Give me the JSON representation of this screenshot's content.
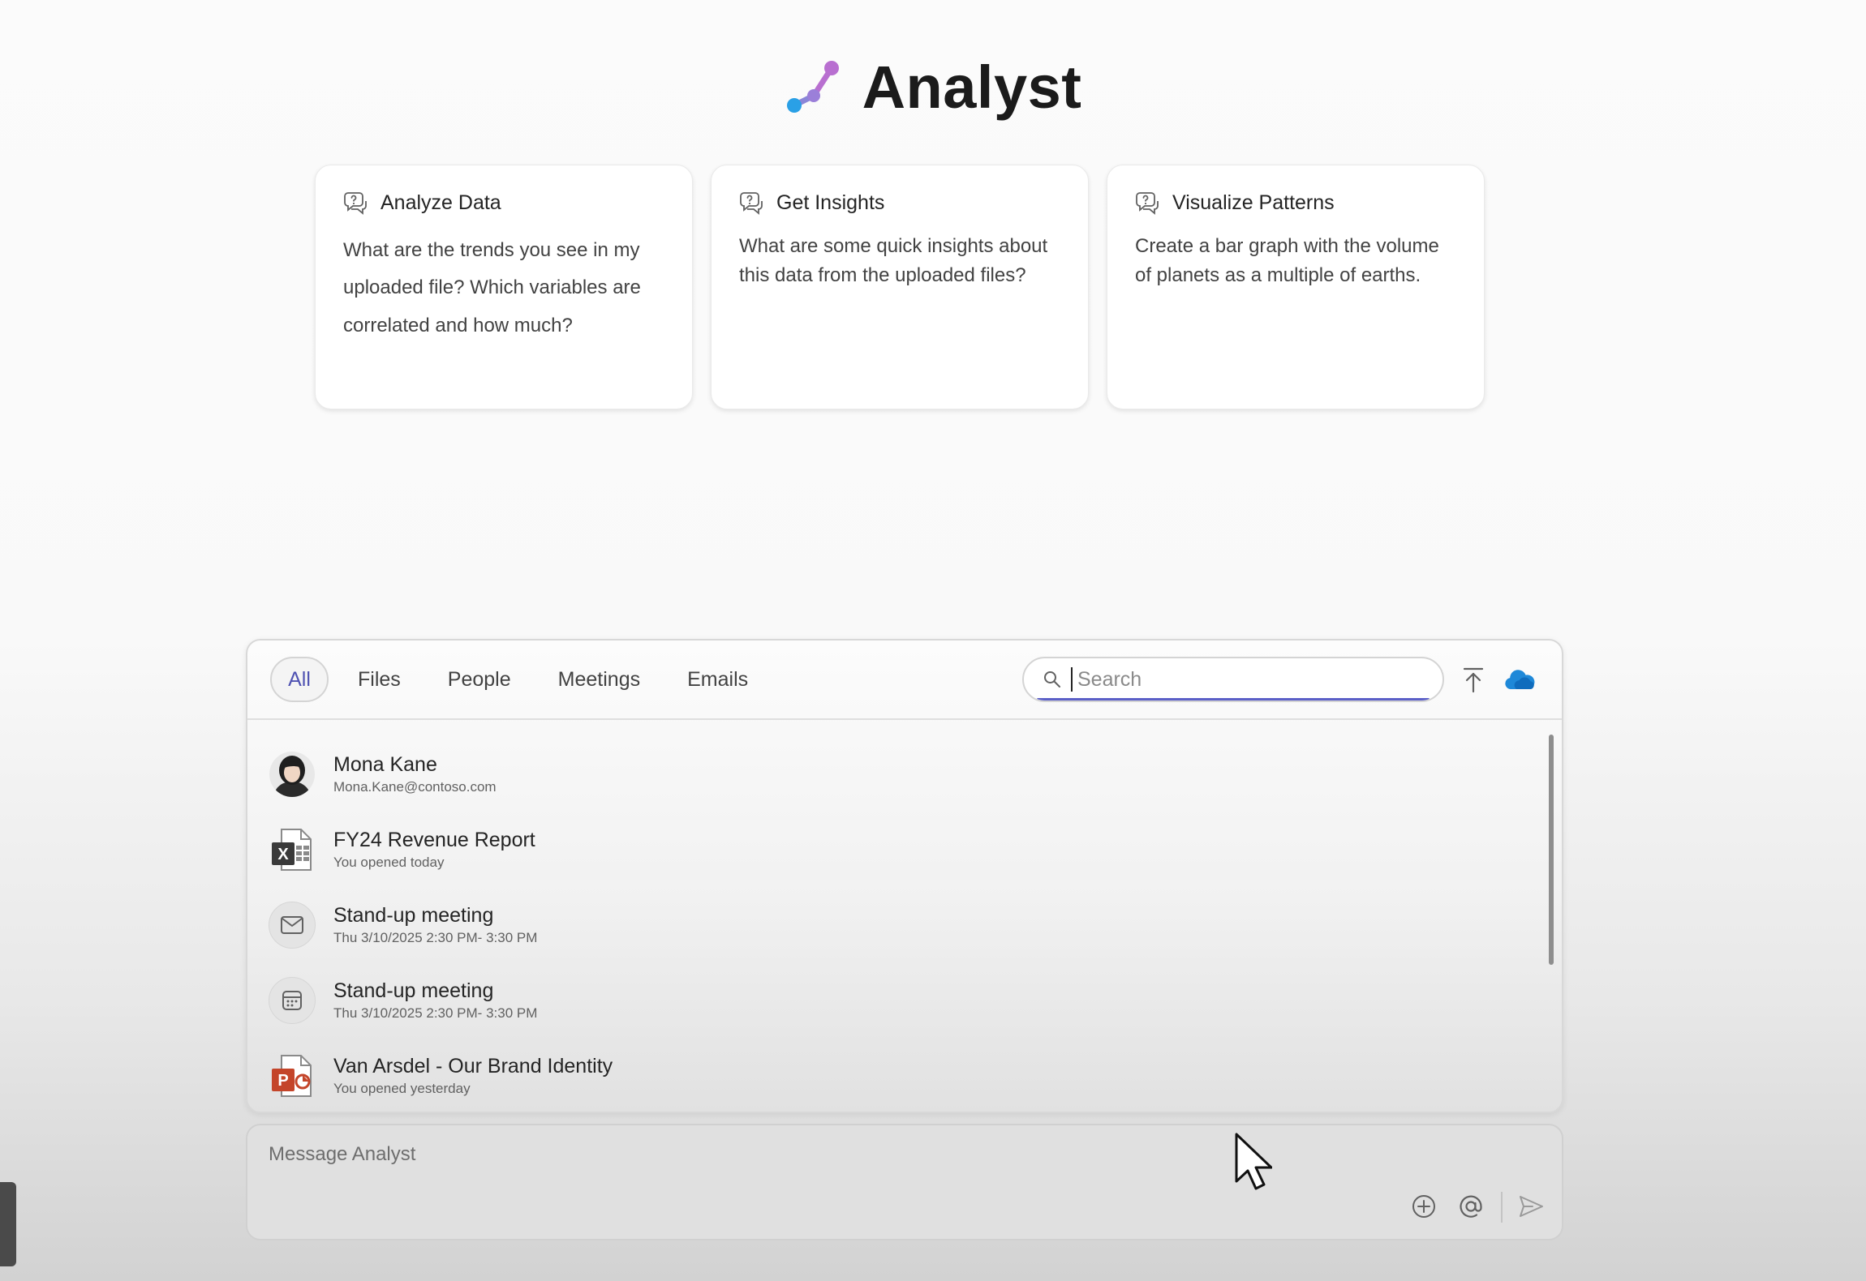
{
  "app": {
    "title": "Analyst"
  },
  "colors": {
    "accent": "#5b5fc7",
    "logo_pink": "#b86fd0",
    "logo_blue": "#2aa0e6",
    "excel": "#1f6b42",
    "powerpoint": "#c4452a",
    "onedrive": "#1e88d8"
  },
  "cards": [
    {
      "title": "Analyze Data",
      "icon": "chat-question-icon",
      "text": "What are the trends you see in my uploaded file? Which variables are correlated and how much?"
    },
    {
      "title": "Get Insights",
      "icon": "chat-question-icon",
      "text": "What are some quick insights about this data from the uploaded files?"
    },
    {
      "title": "Visualize Patterns",
      "icon": "chat-question-icon",
      "text": "Create a bar graph with the volume of planets as a multiple of earths."
    }
  ],
  "picker": {
    "tabs": [
      "All",
      "Files",
      "People",
      "Meetings",
      "Emails"
    ],
    "active_tab": "All",
    "search": {
      "placeholder": "Search",
      "value": ""
    },
    "items": [
      {
        "title": "Mona Kane",
        "subtitle": "Mona.Kane@contoso.com",
        "icon": "avatar"
      },
      {
        "title": "FY24 Revenue Report",
        "subtitle": "You opened today",
        "icon": "excel-file-icon"
      },
      {
        "title": "Stand-up meeting",
        "subtitle": "Thu 3/10/2025 2:30 PM- 3:30 PM",
        "icon": "mail-icon"
      },
      {
        "title": "Stand-up meeting",
        "subtitle": "Thu 3/10/2025 2:30 PM- 3:30 PM",
        "icon": "calendar-icon"
      },
      {
        "title": "Van Arsdel - Our Brand Identity",
        "subtitle": "You opened yesterday",
        "icon": "powerpoint-file-icon"
      }
    ]
  },
  "composer": {
    "placeholder": "Message Analyst"
  }
}
